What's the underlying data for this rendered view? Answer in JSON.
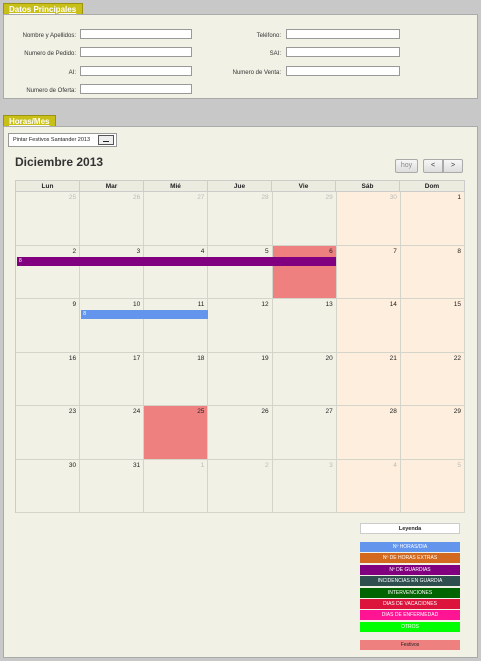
{
  "sections": {
    "datos_title": "Datos Principales",
    "horas_title": "Horas/Mes"
  },
  "form": {
    "nombre_label": "Nombre y Apellidos:",
    "pedido_label": "Numero de Pedido:",
    "al_label": "AI:",
    "oferta_label": "Numero de Oferta:",
    "telefono_label": "Teléfono:",
    "sai_label": "SAI:",
    "venta_label": "Numero de Venta:",
    "nombre_value": "",
    "pedido_value": "",
    "al_value": "",
    "oferta_value": "",
    "telefono_value": "",
    "sai_value": "",
    "venta_value": ""
  },
  "toolbar": {
    "festivos_button": "Pintar Festivos Santander 2013"
  },
  "calendar": {
    "title": "Diciembre 2013",
    "today_label": "hoy",
    "prev_label": "<",
    "next_label": ">",
    "weekdays": [
      "Lun",
      "Mar",
      "Mié",
      "Jue",
      "Vie",
      "Sáb",
      "Dom"
    ],
    "weeks": [
      [
        "25",
        "26",
        "27",
        "28",
        "29",
        "30",
        "1"
      ],
      [
        "2",
        "3",
        "4",
        "5",
        "6",
        "7",
        "8"
      ],
      [
        "9",
        "10",
        "11",
        "12",
        "13",
        "14",
        "15"
      ],
      [
        "16",
        "17",
        "18",
        "19",
        "20",
        "21",
        "22"
      ],
      [
        "23",
        "24",
        "25",
        "26",
        "27",
        "28",
        "29"
      ],
      [
        "30",
        "31",
        "1",
        "2",
        "3",
        "4",
        "5"
      ]
    ],
    "events": [
      {
        "label": "8",
        "color": "#800080"
      },
      {
        "label": "8",
        "color": "#6495ed"
      }
    ],
    "holiday_color": "#ef8080",
    "weekend_color": "#fdeedd"
  },
  "legend": {
    "title": "Leyenda",
    "items": [
      {
        "label": "Nº HORAS/DIA",
        "color": "#6495ed"
      },
      {
        "label": "Nº DE HORAS EXTRAS",
        "color": "#d2691e"
      },
      {
        "label": "Nº DE GUARDIAS",
        "color": "#800080"
      },
      {
        "label": "INCIDENCIAS EN GUARDIA",
        "color": "#2f4f4f"
      },
      {
        "label": "INTERVENCIONES",
        "color": "#006400"
      },
      {
        "label": "DIAS DE VACACIONES",
        "color": "#dc143c"
      },
      {
        "label": "DIAS DE ENFERMEDAD",
        "color": "#ff1493"
      },
      {
        "label": "OTROS",
        "color": "#00ff00"
      }
    ],
    "festivos_label": "Festivos",
    "festivos_color": "#ef8080"
  }
}
